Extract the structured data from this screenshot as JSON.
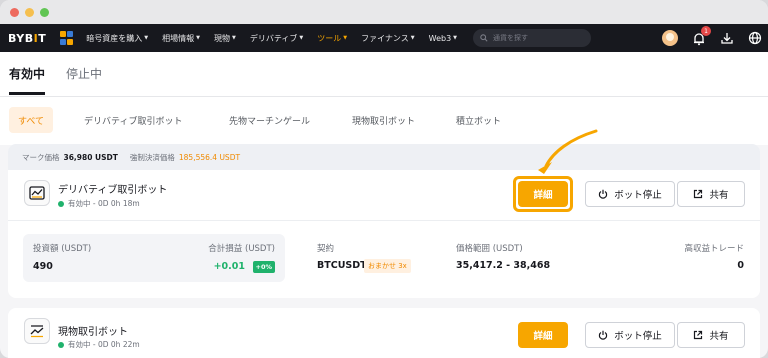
{
  "nav": {
    "logo": [
      "BYB",
      "I",
      "T"
    ],
    "items": [
      {
        "label": "暗号資産を購入",
        "active": false
      },
      {
        "label": "相場情報",
        "active": false
      },
      {
        "label": "現物",
        "active": false
      },
      {
        "label": "デリバティブ",
        "active": false
      },
      {
        "label": "ツール",
        "active": true
      },
      {
        "label": "ファイナンス",
        "active": false
      },
      {
        "label": "Web3",
        "active": false
      }
    ],
    "search_placeholder": "通貨を探す",
    "notification_count": "1"
  },
  "status_tabs": {
    "active": "有効中",
    "inactive": "停止中"
  },
  "filters": [
    "すべて",
    "デリバティブ取引ボット",
    "先物マーチンゲール",
    "現物取引ボット",
    "積立ボット"
  ],
  "card1": {
    "mark_price_label": "マーク価格",
    "mark_price": "36,980 USDT",
    "liq_price_label": "強制決済価格",
    "liq_price": "185,556.4 USDT",
    "title": "デリバティブ取引ボット",
    "status": "有効中 - 0D 0h 18m",
    "detail_label": "詳細",
    "stop_label": "ボット停止",
    "share_label": "共有",
    "investment_label": "投資額 (USDT)",
    "investment_value": "490",
    "pnl_label": "合計損益 (USDT)",
    "pnl_value": "+0.01",
    "pnl_pct": "+0%",
    "contract_label": "契約",
    "contract_value": "BTCUSDT",
    "mode_badge": "おまかせ 3x",
    "range_label": "価格範囲 (USDT)",
    "range_value": "35,417.2 - 38,468",
    "trade_label": "高収益トレード",
    "trade_value": "0"
  },
  "card2": {
    "title": "現物取引ボット",
    "status": "有効中 - 0D 0h 22m",
    "detail_label": "詳細",
    "stop_label": "ボット停止",
    "share_label": "共有"
  },
  "colors": {
    "accent": "#f7a600",
    "green": "#20b26c",
    "nav_bg": "#17181e"
  }
}
